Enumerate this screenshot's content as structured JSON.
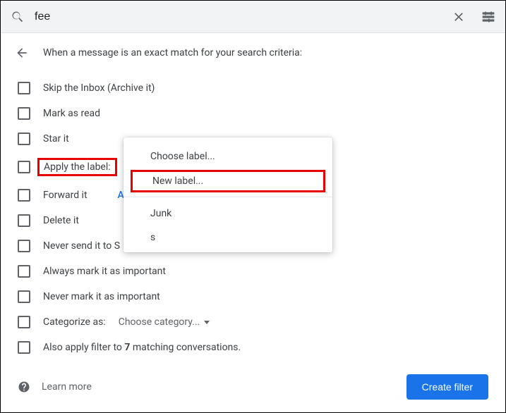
{
  "search": {
    "value": "fee"
  },
  "header": "When a message is an exact match for your search criteria:",
  "options": {
    "skip_inbox": "Skip the Inbox (Archive it)",
    "mark_read": "Mark as read",
    "star": "Star it",
    "apply_label": "Apply the label:",
    "forward": "Forward it",
    "forward_link": "Ad",
    "delete": "Delete it",
    "never_spam": "Never send it to S",
    "always_important": "Always mark it as important",
    "never_important": "Never mark it as important",
    "categorize": "Categorize as:",
    "categorize_choose": "Choose category...",
    "also_apply_pre": "Also apply filter to ",
    "also_apply_num": "7",
    "also_apply_post": " matching conversations."
  },
  "dropdown": {
    "choose": "Choose label...",
    "new": "New label...",
    "items": [
      "Junk",
      "s"
    ]
  },
  "footer": {
    "learn_more": "Learn more",
    "create": "Create filter"
  }
}
